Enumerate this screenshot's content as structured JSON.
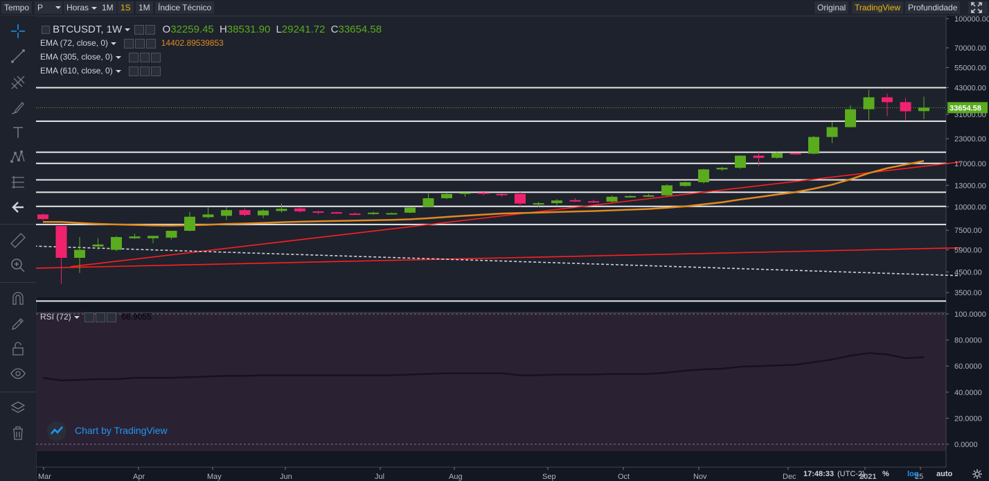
{
  "toolbar": {
    "tempo": "Tempo",
    "interval": "P",
    "horas": "Horas",
    "btn_1m_a": "1M",
    "btn_1s": "1S",
    "btn_1m_b": "1M",
    "indicator": "Índice Técnico",
    "view_original": "Original",
    "view_tradingview": "TradingView",
    "view_depth": "Profundidade"
  },
  "legend": {
    "symbol": "BTCUSDT, 1W",
    "o_label": "O",
    "o_value": "32259.45",
    "h_label": "H",
    "h_value": "38531.90",
    "l_label": "L",
    "l_value": "29241.72",
    "c_label": "C",
    "c_value": "33654.58",
    "ema1": "EMA (72, close, 0)",
    "ema1_value": "14402.89539853",
    "ema2": "EMA (305, close, 0)",
    "ema3": "EMA (610, close, 0)",
    "rsi": "RSI (72)",
    "rsi_value": "66.9055"
  },
  "watermark": "Chart by TradingView",
  "price_axis": [
    "100000.00",
    "70000.00",
    "55000.00",
    "43000.00",
    "31000.00",
    "23000.00",
    "17000.00",
    "13000.00",
    "10000.00",
    "7500.00",
    "5900.00",
    "4500.00",
    "3500.00"
  ],
  "current_price": "33654.58",
  "rsi_axis": [
    "100.0000",
    "80.0000",
    "60.0000",
    "40.0000",
    "20.0000",
    "0.0000"
  ],
  "time_axis": [
    "Mar",
    "Apr",
    "May",
    "Jun",
    "Jul",
    "Aug",
    "Sep",
    "Oct",
    "Nov",
    "Dec",
    "2021",
    "25"
  ],
  "status": {
    "time": "17:48:33",
    "tz": "(UTC-2)",
    "percent": "%",
    "log": "log",
    "auto": "auto"
  },
  "colors": {
    "up": "#53b987",
    "up_candle": "#5aab1e",
    "down": "#eb4d5c",
    "down_candle": "#f0226e",
    "ema72": "#e08a1e",
    "trend_red": "#ff1f1f",
    "accent": "#f0b90b",
    "watermark": "#2196f3"
  },
  "chart_data": {
    "type": "candlestick",
    "timeframe": "1W",
    "scale": "log",
    "symbol": "BTCUSDT",
    "candles": [
      {
        "o": 9100,
        "h": 9200,
        "l": 8450,
        "c": 8600
      },
      {
        "o": 7900,
        "h": 8000,
        "l": 3900,
        "c": 5350
      },
      {
        "o": 5350,
        "h": 6900,
        "l": 4450,
        "c": 5900
      },
      {
        "o": 6150,
        "h": 6800,
        "l": 5900,
        "c": 6300
      },
      {
        "o": 5900,
        "h": 7000,
        "l": 5800,
        "c": 6900
      },
      {
        "o": 6800,
        "h": 7200,
        "l": 6750,
        "c": 6950
      },
      {
        "o": 6800,
        "h": 7000,
        "l": 6400,
        "c": 7000
      },
      {
        "o": 6850,
        "h": 7100,
        "l": 6700,
        "c": 7450
      },
      {
        "o": 7450,
        "h": 9400,
        "l": 7400,
        "c": 8850
      },
      {
        "o": 8800,
        "h": 10000,
        "l": 8650,
        "c": 9100
      },
      {
        "o": 8950,
        "h": 10000,
        "l": 8500,
        "c": 9600
      },
      {
        "o": 9600,
        "h": 9800,
        "l": 8900,
        "c": 9050
      },
      {
        "o": 9000,
        "h": 9700,
        "l": 8700,
        "c": 9550
      },
      {
        "o": 9500,
        "h": 10400,
        "l": 9300,
        "c": 9750
      },
      {
        "o": 9800,
        "h": 9900,
        "l": 9300,
        "c": 9450
      },
      {
        "o": 9450,
        "h": 9500,
        "l": 9100,
        "c": 9300
      },
      {
        "o": 9350,
        "h": 9400,
        "l": 9200,
        "c": 9200
      },
      {
        "o": 9200,
        "h": 9300,
        "l": 9100,
        "c": 9150
      },
      {
        "o": 9150,
        "h": 9400,
        "l": 9050,
        "c": 9300
      },
      {
        "o": 9250,
        "h": 9300,
        "l": 9100,
        "c": 9250
      },
      {
        "o": 9300,
        "h": 10000,
        "l": 9250,
        "c": 9900
      },
      {
        "o": 10000,
        "h": 11900,
        "l": 10000,
        "c": 11100
      },
      {
        "o": 11100,
        "h": 11900,
        "l": 11000,
        "c": 11700
      },
      {
        "o": 11700,
        "h": 11900,
        "l": 11300,
        "c": 11900
      },
      {
        "o": 11900,
        "h": 12200,
        "l": 11500,
        "c": 11700
      },
      {
        "o": 11700,
        "h": 11800,
        "l": 11300,
        "c": 11650
      },
      {
        "o": 11700,
        "h": 12000,
        "l": 9900,
        "c": 10400
      },
      {
        "o": 10300,
        "h": 10600,
        "l": 10000,
        "c": 10450
      },
      {
        "o": 10450,
        "h": 11000,
        "l": 10200,
        "c": 10800
      },
      {
        "o": 10850,
        "h": 11100,
        "l": 10600,
        "c": 10650
      },
      {
        "o": 10700,
        "h": 10900,
        "l": 10500,
        "c": 10650
      },
      {
        "o": 10650,
        "h": 11500,
        "l": 10550,
        "c": 11300
      },
      {
        "o": 11300,
        "h": 11500,
        "l": 11200,
        "c": 11400
      },
      {
        "o": 11400,
        "h": 11700,
        "l": 11300,
        "c": 11500
      },
      {
        "o": 11500,
        "h": 13200,
        "l": 11400,
        "c": 13000
      },
      {
        "o": 12900,
        "h": 13600,
        "l": 12800,
        "c": 13500
      },
      {
        "o": 13500,
        "h": 15900,
        "l": 13300,
        "c": 15800
      },
      {
        "o": 15800,
        "h": 16300,
        "l": 15500,
        "c": 16100
      },
      {
        "o": 16100,
        "h": 18800,
        "l": 15900,
        "c": 18700
      },
      {
        "o": 18700,
        "h": 19500,
        "l": 16500,
        "c": 18200
      },
      {
        "o": 18200,
        "h": 19700,
        "l": 18000,
        "c": 19300
      },
      {
        "o": 19300,
        "h": 19400,
        "l": 18900,
        "c": 19100
      },
      {
        "o": 19150,
        "h": 23800,
        "l": 19000,
        "c": 23500
      },
      {
        "o": 23500,
        "h": 28300,
        "l": 21800,
        "c": 26500
      },
      {
        "o": 26500,
        "h": 34700,
        "l": 26400,
        "c": 33000
      },
      {
        "o": 33000,
        "h": 41900,
        "l": 28900,
        "c": 38200
      },
      {
        "o": 38200,
        "h": 40000,
        "l": 30300,
        "c": 36000
      },
      {
        "o": 36000,
        "h": 37900,
        "l": 28800,
        "c": 32200
      },
      {
        "o": 32259.45,
        "h": 38531.9,
        "l": 29241.72,
        "c": 33654.58
      }
    ],
    "horizontal_levels": [
      43000,
      28500,
      19500,
      17000,
      13900,
      11950,
      10050,
      8050,
      3150
    ],
    "rsi_values": [
      51,
      49,
      49.5,
      50,
      50,
      51,
      51,
      51,
      51.5,
      52,
      52.5,
      52.5,
      53,
      53,
      53,
      53,
      53,
      53,
      53,
      53,
      53.5,
      54,
      54.5,
      54.5,
      54.5,
      54.5,
      53,
      53,
      53.5,
      53.5,
      53.5,
      54,
      54,
      54,
      55,
      56.5,
      57.5,
      58,
      59.5,
      60,
      60.5,
      61,
      63,
      65,
      68,
      70,
      69,
      66,
      66.9
    ],
    "xlabel": "",
    "ylabel": ""
  }
}
